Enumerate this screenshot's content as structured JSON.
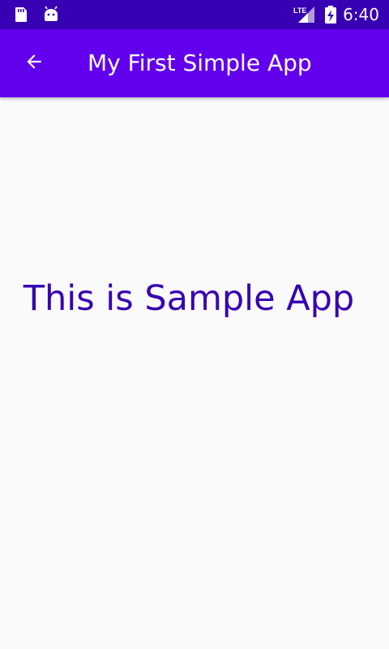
{
  "status_bar": {
    "time": "6:40",
    "icons": [
      "sd-card-icon",
      "android-icon",
      "lte-signal-icon",
      "battery-charging-icon"
    ],
    "background": "#3700b3"
  },
  "app_bar": {
    "title": "My First Simple App",
    "background": "#6200ee",
    "back_icon": "arrow-back-icon"
  },
  "main": {
    "text": "This is Sample App",
    "text_color": "#3700b3",
    "background": "#fafafa"
  }
}
